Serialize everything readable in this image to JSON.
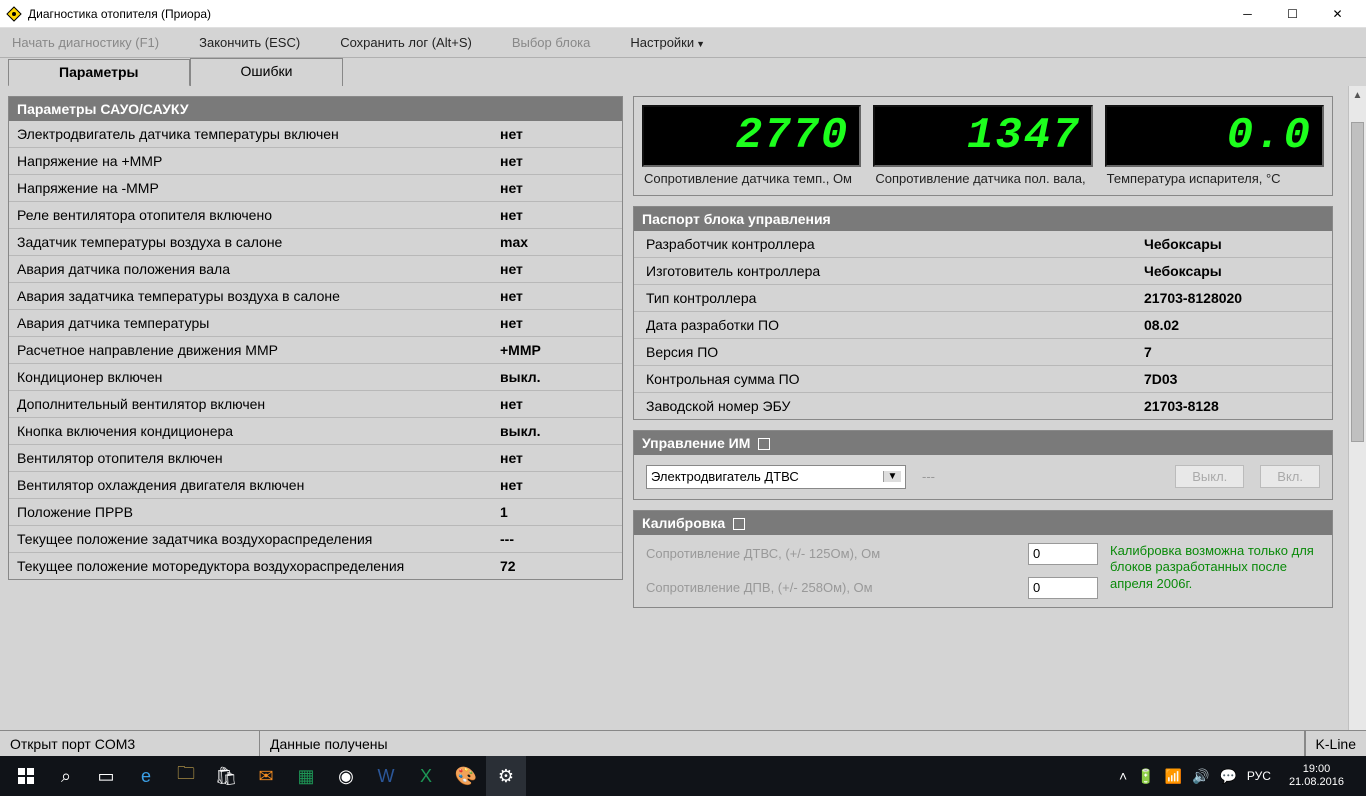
{
  "window": {
    "title": "Диагностика отопителя (Приора)"
  },
  "menu": {
    "start": "Начать диагностику (F1)",
    "finish": "Закончить (ESC)",
    "savelog": "Сохранить лог (Alt+S)",
    "selectblock": "Выбор блока",
    "settings": "Настройки"
  },
  "tabs": {
    "params": "Параметры",
    "errors": "Ошибки"
  },
  "params_header": "Параметры САУО/САУКУ",
  "params": [
    {
      "label": "Электродвигатель датчика температуры включен",
      "value": "нет"
    },
    {
      "label": "Напряжение на +ММР",
      "value": "нет"
    },
    {
      "label": "Напряжение на -ММР",
      "value": "нет"
    },
    {
      "label": "Реле вентилятора отопителя включено",
      "value": "нет"
    },
    {
      "label": "Задатчик температуры воздуха в салоне",
      "value": "max"
    },
    {
      "label": "Авария датчика положения вала",
      "value": "нет"
    },
    {
      "label": "Авария задатчика температуры воздуха в салоне",
      "value": "нет"
    },
    {
      "label": "Авария датчика температуры",
      "value": "нет"
    },
    {
      "label": "Расчетное направление движения ММР",
      "value": "+ММР"
    },
    {
      "label": "Кондиционер включен",
      "value": "выкл."
    },
    {
      "label": "Дополнительный вентилятор включен",
      "value": "нет"
    },
    {
      "label": "Кнопка включения кондиционера",
      "value": "выкл."
    },
    {
      "label": "Вентилятор отопителя включен",
      "value": "нет"
    },
    {
      "label": "Вентилятор охлаждения двигателя включен",
      "value": "нет"
    },
    {
      "label": "Положение ПРРВ",
      "value": "1"
    },
    {
      "label": "Текущее положение задатчика воздухораспределения",
      "value": "---"
    },
    {
      "label": "Текущее положение моторедуктора воздухораспределения",
      "value": "72"
    }
  ],
  "displays": [
    {
      "value": "2770",
      "label": "Сопротивление датчика темп., Ом"
    },
    {
      "value": "1347",
      "label": "Сопротивление датчика пол. вала,"
    },
    {
      "value": "0.0",
      "label": "Температура испарителя, °C"
    }
  ],
  "passport_header": "Паспорт блока управления",
  "passport": [
    {
      "label": "Разработчик контроллера",
      "value": "Чебоксары"
    },
    {
      "label": "Изготовитель контроллера",
      "value": "Чебоксары"
    },
    {
      "label": "Тип контроллера",
      "value": "21703-8128020"
    },
    {
      "label": "Дата разработки ПО",
      "value": "08.02"
    },
    {
      "label": "Версия ПО",
      "value": "7"
    },
    {
      "label": "Контрольная сумма ПО",
      "value": "7D03"
    },
    {
      "label": "Заводской номер ЭБУ",
      "value": "21703-8128"
    }
  ],
  "control_im": {
    "header": "Управление ИМ",
    "select": "Электродвигатель ДТВС",
    "dash": "---",
    "off": "Выкл.",
    "on": "Вкл."
  },
  "calibration": {
    "header": "Калибровка",
    "rows": [
      {
        "label": "Сопротивление ДТВС, (+/- 125Ом), Ом",
        "value": "0"
      },
      {
        "label": "Сопротивление ДПВ, (+/- 258Ом), Ом",
        "value": "0"
      }
    ],
    "note": "Калибровка возможна только для блоков разработанных после апреля 2006г."
  },
  "status": {
    "port": "Открыт порт COM3",
    "data": "Данные получены",
    "kline": "K-Line"
  },
  "taskbar": {
    "lang": "РУС",
    "time": "19:00",
    "date": "21.08.2016"
  }
}
